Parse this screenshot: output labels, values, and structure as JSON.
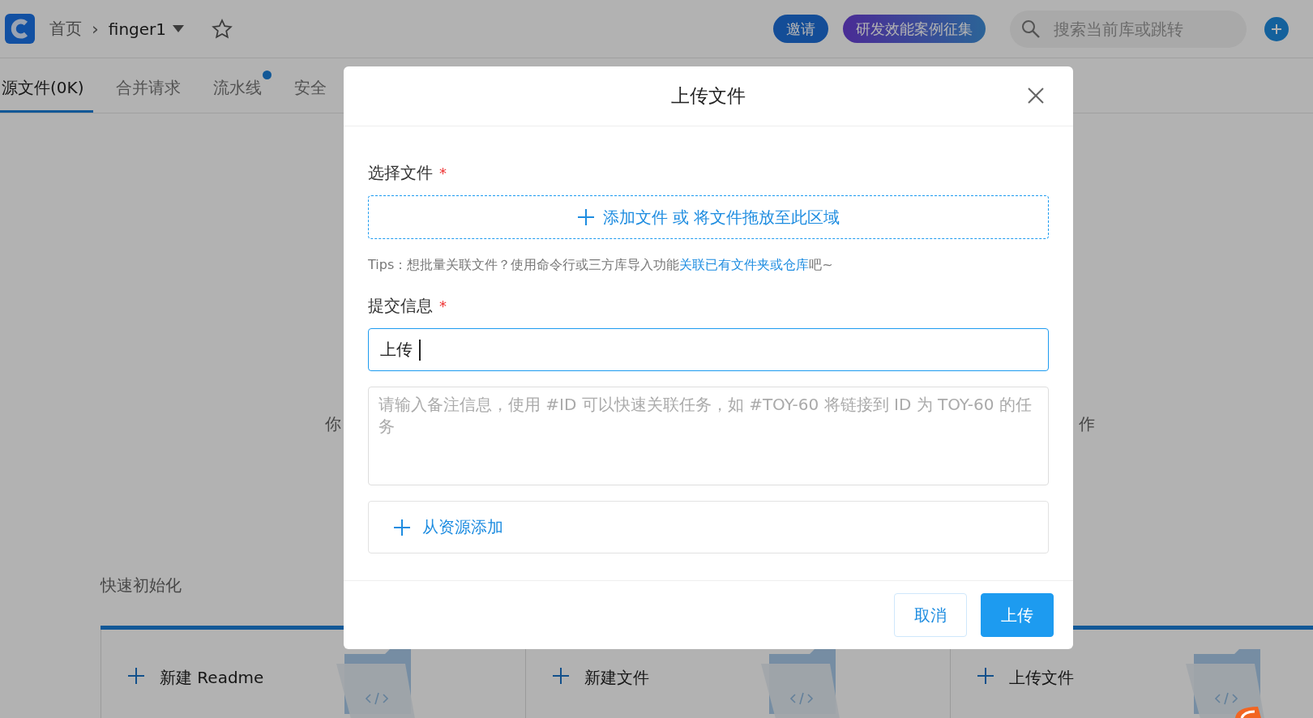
{
  "header": {
    "breadcrumb_home": "首页",
    "breadcrumb_separator": "›",
    "repo": "finger1",
    "starred": false,
    "invite": "邀请",
    "campaign": "研发效能案例征集",
    "search": {
      "placeholder": "搜索当前库或跳转"
    }
  },
  "tabs": [
    {
      "label": "源文件(0K)",
      "selected": true,
      "badge": false
    },
    {
      "label": "合并请求",
      "selected": false,
      "badge": false
    },
    {
      "label": "流水线",
      "selected": false,
      "badge": true
    },
    {
      "label": "安全",
      "selected": false,
      "badge": false
    }
  ],
  "background": {
    "hint_fragments": [
      "你",
      "作"
    ],
    "quick_init": {
      "title": "快速初始化",
      "cards": [
        {
          "label": "新建 Readme"
        },
        {
          "label": "新建文件"
        },
        {
          "label": "上传文件"
        }
      ]
    }
  },
  "dialog": {
    "title": "上传文件",
    "file": {
      "label": "选择文件",
      "required_mark": "*",
      "dropzone": "添加文件 或 将文件拖放至此区域"
    },
    "tips": {
      "before": "Tips：想批量关联文件？使用命令行或三方库导入功能",
      "link": "关联已有文件夹或仓库",
      "after": "吧~"
    },
    "commit": {
      "label": "提交信息",
      "required_mark": "*",
      "value": "上传",
      "focused": true,
      "note_placeholder": "请输入备注信息，使用 #ID 可以快速关联任务，如 #TOY-60 将链接到 ID 为 TOY-60 的任务"
    },
    "resource_add": "从资源添加",
    "buttons": [
      {
        "label": "取消",
        "kind": "secondary"
      },
      {
        "label": "上传",
        "kind": "primary"
      }
    ]
  }
}
